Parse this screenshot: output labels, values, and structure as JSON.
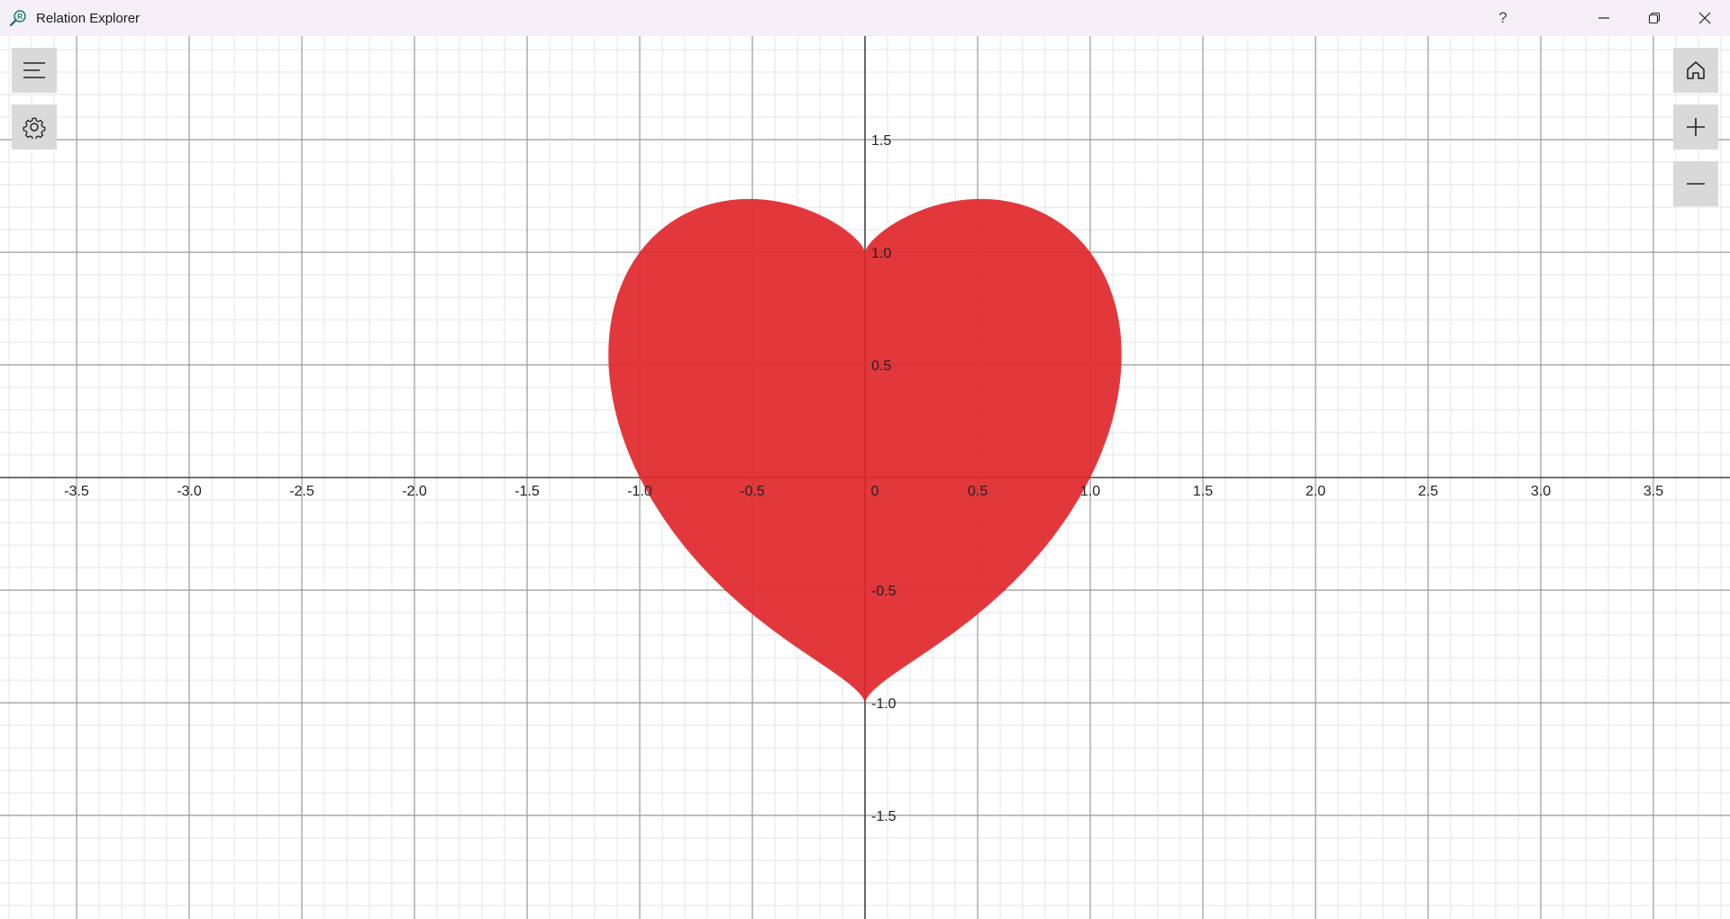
{
  "window": {
    "title": "Relation Explorer",
    "help_label": "?",
    "minimize_icon": "minimize-icon",
    "restore_icon": "restore-icon",
    "close_icon": "close-icon"
  },
  "toolbar_left": {
    "menu_icon": "hamburger-menu-icon",
    "settings_icon": "gear-icon"
  },
  "toolbar_right": {
    "home_icon": "home-icon",
    "zoom_in_icon": "plus-icon",
    "zoom_out_icon": "minus-icon"
  },
  "graph": {
    "fill_color": "#e0272b",
    "fill_opacity": 0.92,
    "axis_color": "#444444",
    "major_grid_color": "#9a9a9a",
    "minor_grid_color": "#e4e4e4",
    "x_ticks": [
      "-3.5",
      "-3.0",
      "-2.5",
      "-2.0",
      "-1.5",
      "-1.0",
      "-0.5",
      "0",
      "0.5",
      "1.0",
      "1.5",
      "2.0",
      "2.5",
      "3.0",
      "3.5"
    ],
    "y_ticks": [
      "1.5",
      "1.0",
      "0.5",
      "-0.5",
      "-1.0",
      "-1.5"
    ],
    "x_range": [
      -3.84,
      3.84
    ],
    "y_range": [
      -1.95,
      1.95
    ],
    "shape": "heart"
  }
}
